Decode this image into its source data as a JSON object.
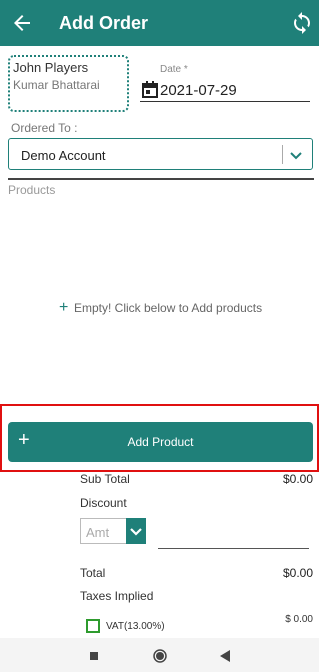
{
  "appbar": {
    "title": "Add Order",
    "back_icon": "arrow-left-icon",
    "sync_icon": "sync-icon",
    "color": "#1f8079"
  },
  "customer": {
    "name": "John Players",
    "subtitle": "Kumar Bhattarai"
  },
  "date": {
    "label": "Date *",
    "value": "2021-07-29",
    "icon": "calendar-icon"
  },
  "ordered_to": {
    "label": "Ordered To :",
    "value": "Demo Account",
    "icon": "chevron-down-icon"
  },
  "products": {
    "label": "Products",
    "empty_text": "Empty! Click below to Add products",
    "empty_icon": "+"
  },
  "add_product": {
    "icon": "+",
    "label": "Add Product",
    "highlight_color": "#e01010"
  },
  "summary": {
    "sub_total_label": "Sub Total",
    "sub_total_value": "$0.00",
    "discount_label": "Discount",
    "discount_type": "Amt",
    "total_label": "Total",
    "total_value": "$0.00",
    "taxes_label": "Taxes Implied",
    "vat_label": "VAT(13.00%)",
    "vat_value": "$ 0.00"
  }
}
